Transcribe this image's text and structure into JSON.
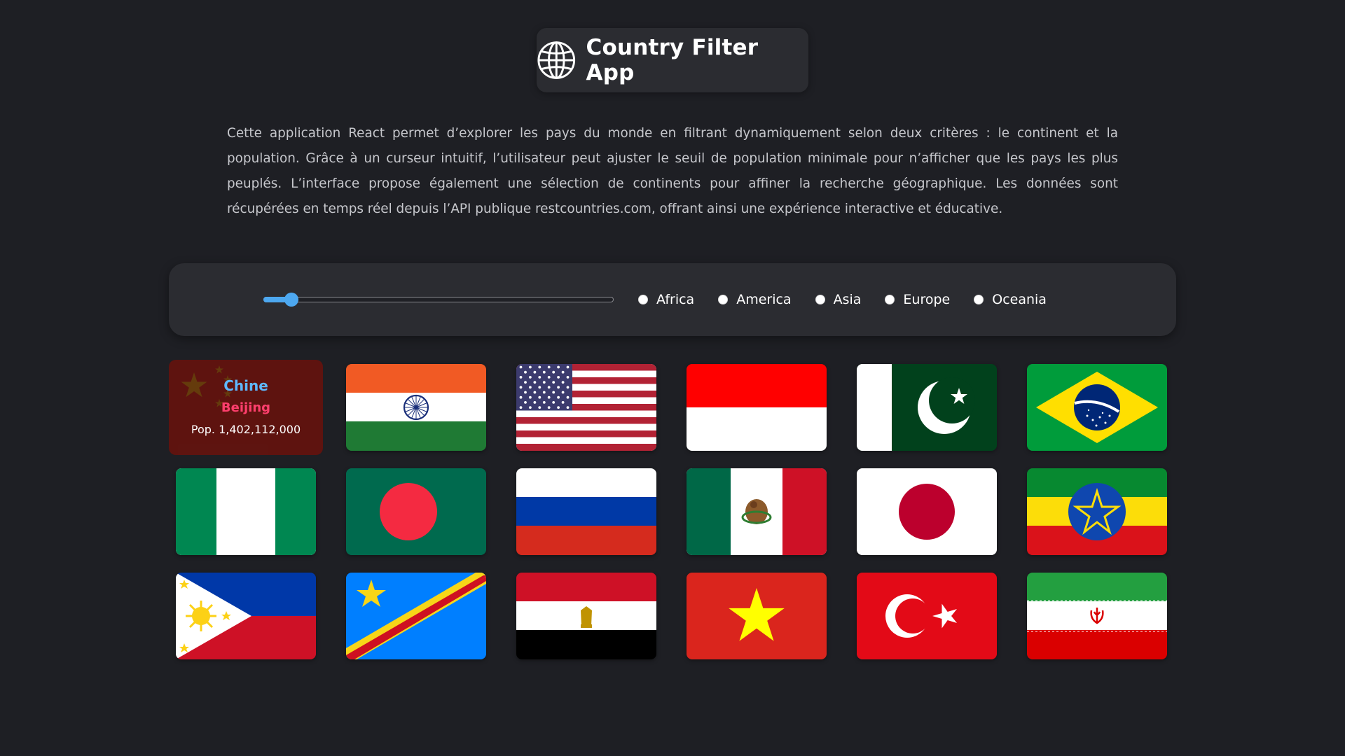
{
  "header": {
    "title": "Country Filter App",
    "icon": "globe-icon"
  },
  "description": "Cette application React permet d’explorer les pays du monde en filtrant dynamiquement selon deux critères : le continent et la population. Grâce à un curseur intuitif, l’utilisateur peut ajuster le seuil de population minimale pour n’afficher que les pays les plus peuplés. L’interface propose également une sélection de continents pour affiner la recherche géographique. Les données sont récupérées en temps réel depuis l’API publique restcountries.com, offrant ainsi une expérience interactive et éducative.",
  "filters": {
    "population_slider": {
      "value_fraction": 0.08,
      "accent": "#4da8f0"
    },
    "continents": [
      {
        "label": "Africa",
        "selected": false
      },
      {
        "label": "America",
        "selected": false
      },
      {
        "label": "Asia",
        "selected": false
      },
      {
        "label": "Europe",
        "selected": false
      },
      {
        "label": "Oceania",
        "selected": false
      }
    ]
  },
  "hovered_country": {
    "name": "Chine",
    "capital": "Beijing",
    "population": "Pop. 1,402,112,000"
  },
  "flags": [
    {
      "country": "china"
    },
    {
      "country": "india"
    },
    {
      "country": "united-states"
    },
    {
      "country": "indonesia"
    },
    {
      "country": "pakistan"
    },
    {
      "country": "brazil"
    },
    {
      "country": "nigeria"
    },
    {
      "country": "bangladesh"
    },
    {
      "country": "russia"
    },
    {
      "country": "mexico"
    },
    {
      "country": "japan"
    },
    {
      "country": "ethiopia"
    },
    {
      "country": "philippines"
    },
    {
      "country": "dr-congo"
    },
    {
      "country": "egypt"
    },
    {
      "country": "vietnam"
    },
    {
      "country": "turkey"
    },
    {
      "country": "iran"
    }
  ],
  "colors": {
    "background": "#1e1f24",
    "panel": "#2b2c31",
    "country_name": "#5eb8ff",
    "capital": "#ff3f6d"
  }
}
